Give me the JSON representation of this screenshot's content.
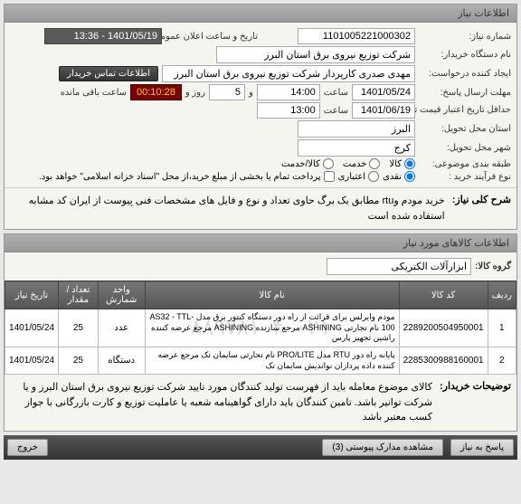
{
  "panels": {
    "need_info_title": "اطلاعات نیاز"
  },
  "header": {
    "need_number_label": "شماره نیاز:",
    "need_number": "1101005221000302",
    "announce_label": "تاریخ و ساعت اعلان عمومی:",
    "announce_value": "1401/05/19 - 13:36",
    "buyer_org_label": "نام دستگاه خریدار:",
    "buyer_org": "شرکت توزیع نیروی برق استان البرز",
    "requester_label": "ایجاد کننده درخواست:",
    "requester": "مهدی صدری کارپرداز شرکت توزیع نیروی برق استان البرز",
    "contact_btn": "اطلاعات تماس خریدار",
    "deadline_label": "مهلت ارسال پاسخ:",
    "deadline_date": "1401/05/24",
    "time_label": "ساعت",
    "deadline_time": "14:00",
    "and_label": "و",
    "days_value": "5",
    "days_label": "روز و",
    "remain_time": "00:10:28",
    "remain_label": "ساعت باقی مانده",
    "validity_label": "حداقل تاریخ اعتبار قیمت تا تاریخ:",
    "validity_date": "1401/06/19",
    "validity_time": "13:00",
    "province_label": "استان محل تحویل:",
    "province": "البرز",
    "city_label": "شهر محل تحویل:",
    "city": "کرج",
    "category_label": "طبقه بندی موضوعی:",
    "cat_goods": "کالا",
    "cat_service": "خدمت",
    "cat_both": "کالا/خدمت",
    "process_label": "نوع فرآیند خرید :",
    "process_cash": "نقدی",
    "process_credit": "اعتباری",
    "credit_note": "پرداخت تمام یا بخشی از مبلغ خرید،از محل \"اسناد خزانه اسلامی\" خواهد بود."
  },
  "description": {
    "label": "شرح کلی نیاز:",
    "text": "خرید مودم وrtu  مطابق یک برگ حاوی تعداد و نوع و فایل های مشخصات فنی پیوست از ایران کد مشابه استفاده شده است"
  },
  "items_panel": {
    "title": "اطلاعات کالاهای مورد نیاز",
    "group_label": "گروه کالا:",
    "group_value": "ابزارآلات الکتریکی"
  },
  "table": {
    "headers": {
      "row": "ردیف",
      "code": "کد کالا",
      "name": "نام کالا",
      "unit": "واحد شمارش",
      "qty": "تعداد / مقدار",
      "date": "تاریخ نیاز"
    },
    "rows": [
      {
        "idx": "1",
        "code": "2289200504950001",
        "name": "مودم وایرلس برای قرائت از راه دور دستگاه کنتور برق مدل AS32 - TTL-100 نام تجارتی ASHINING مرجع سازنده ASHINING مرجع عرضه کننده راشین تجهیز پارس",
        "unit": "عدد",
        "qty": "25",
        "date": "1401/05/24"
      },
      {
        "idx": "2",
        "code": "2285300988160001",
        "name": "پایانه راه دور RTU مدل PRO/LITE نام تجارتی سایمان تک مرجع عرضه کننده داده پردازان نواندیش سایمان تک",
        "unit": "دستگاه",
        "qty": "25",
        "date": "1401/05/24"
      }
    ],
    "watermark": "۰۲۱–۸۸۹۷۸۱۰۴"
  },
  "buyer_notes": {
    "label": "توضیحات خریدار:",
    "text": "کالای موضوع معامله باید از فهرست تولید کنندگان مورد تایید شرکت توزیع نیروی برق استان البرز و یا شرکت توانیر باشد. تامین کنندگان باید دارای گواهینامه شعبه یا عاملیت توزیع و کارت بازرگانی با جواز کسب معتبر باشد"
  },
  "footer": {
    "reply": "پاسخ به نیاز",
    "attachments": "مشاهده مدارک پیوستی (3)",
    "exit": "خروج"
  }
}
